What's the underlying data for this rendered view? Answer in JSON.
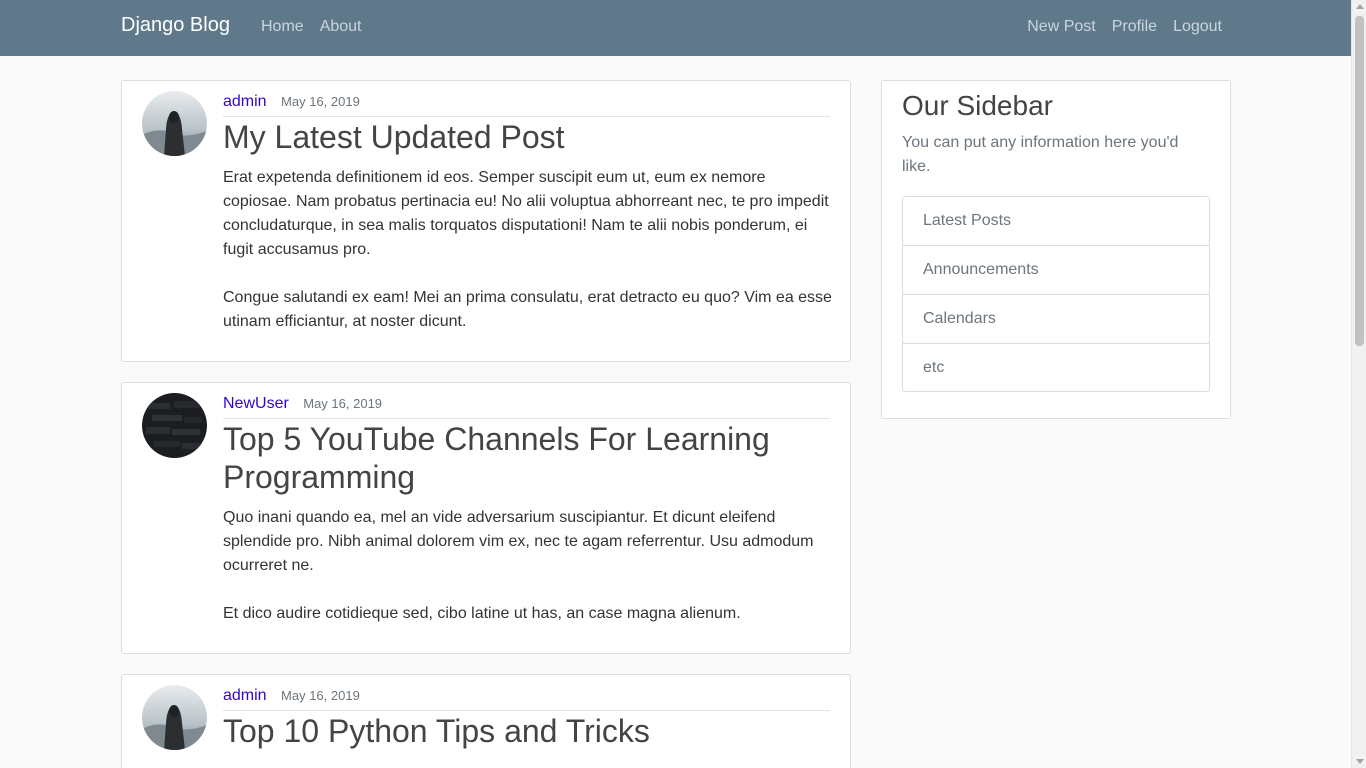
{
  "navbar": {
    "brand": "Django Blog",
    "left_links": [
      "Home",
      "About"
    ],
    "right_links": [
      "New Post",
      "Profile",
      "Logout"
    ]
  },
  "posts": [
    {
      "author": "admin",
      "date": "May 16, 2019",
      "title": "My Latest Updated Post",
      "paragraphs": [
        "Erat expetenda definitionem id eos. Semper suscipit eum ut, eum ex nemore copiosae. Nam probatus pertinacia eu! No alii voluptua abhorreant nec, te pro impedit concludaturque, in sea malis torquatos disputationi! Nam te alii nobis ponderum, ei fugit accusamus pro.",
        "Congue salutandi ex eam! Mei an prima consulatu, erat detracto eu quo? Vim ea esse utinam efficiantur, at noster dicunt."
      ]
    },
    {
      "author": "NewUser",
      "date": "May 16, 2019",
      "title": "Top 5 YouTube Channels For Learning Programming",
      "paragraphs": [
        "Quo inani quando ea, mel an vide adversarium suscipiantur. Et dicunt eleifend splendide pro. Nibh animal dolorem vim ex, nec te agam referrentur. Usu admodum ocurreret ne.",
        "Et dico audire cotidieque sed, cibo latine ut has, an case magna alienum."
      ]
    },
    {
      "author": "admin",
      "date": "May 16, 2019",
      "title": "Top 10 Python Tips and Tricks",
      "paragraphs": []
    }
  ],
  "sidebar": {
    "title": "Our Sidebar",
    "description": "You can put any information here you'd like.",
    "items": [
      "Latest Posts",
      "Announcements",
      "Calendars",
      "etc"
    ]
  },
  "colors": {
    "navbar_bg": "#5f788a",
    "author_link": "#3406c3",
    "page_bg": "#fafafa"
  },
  "icons": {
    "avatar_admin": "hooded-figure-avatar",
    "avatar_newuser": "dark-texture-avatar"
  }
}
